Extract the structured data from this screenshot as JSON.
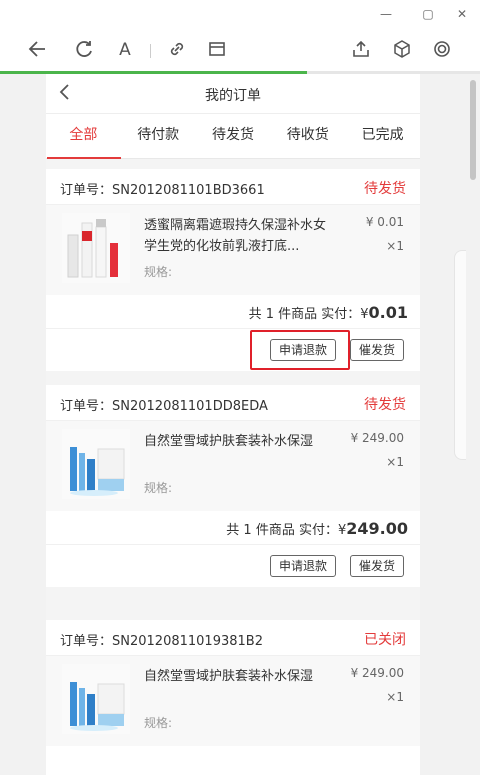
{
  "browser": {
    "progress_fraction": 0.64
  },
  "page": {
    "title": "我的订单",
    "back_icon": "chevron-left-icon"
  },
  "tabs": [
    {
      "label": "全部",
      "active": true
    },
    {
      "label": "待付款",
      "active": false
    },
    {
      "label": "待发货",
      "active": false
    },
    {
      "label": "待收货",
      "active": false
    },
    {
      "label": "已完成",
      "active": false
    }
  ],
  "orders": [
    {
      "order_no_label": "订单号：",
      "order_no": "SN2012081101BD3661",
      "status": "待发货",
      "product_name": "透蜜隔离霜遮瑕持久保湿补水女学生党的化妆前乳液打底...",
      "spec": "规格:",
      "price": "¥ 0.01",
      "qty": "×1",
      "summary_prefix": "共 1 件商品 实付：¥",
      "summary_amount": "0.01",
      "btn_refund": "申请退款",
      "btn_urge": "催发货"
    },
    {
      "order_no_label": "订单号：",
      "order_no": "SN2012081101DD8EDA",
      "status": "待发货",
      "product_name": "自然堂雪域护肤套装补水保湿",
      "spec": "规格:",
      "price": "¥ 249.00",
      "qty": "×1",
      "summary_prefix": "共 1 件商品 实付：¥",
      "summary_amount": "249.00",
      "btn_refund": "申请退款",
      "btn_urge": "催发货"
    },
    {
      "order_no_label": "订单号：",
      "order_no": "SN20120811019381B2",
      "status": "已关闭",
      "product_name": "自然堂雪域护肤套装补水保湿",
      "spec": "规格:",
      "price": "¥ 249.00",
      "qty": "×1"
    }
  ],
  "colors": {
    "accent": "#e33b3b",
    "progress": "#4bb54b",
    "highlight_box": "#e0202a"
  }
}
